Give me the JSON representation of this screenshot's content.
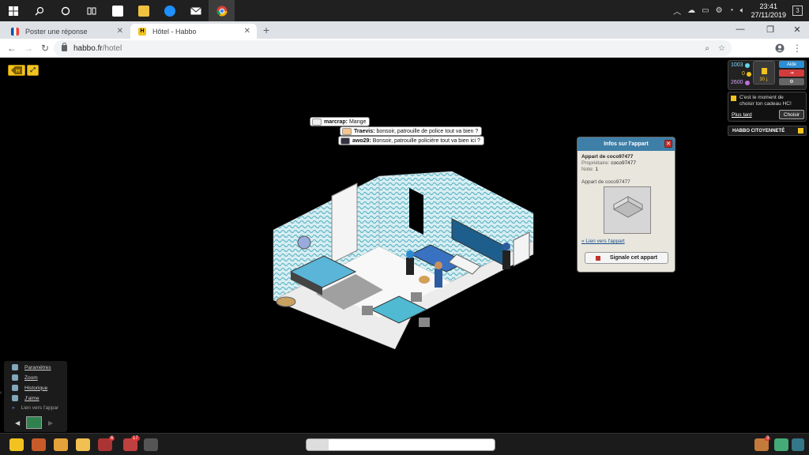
{
  "taskbar": {
    "clock_time": "23:41",
    "clock_date": "27/11/2019",
    "notifications": "3"
  },
  "tabs": [
    {
      "title": "Poster une réponse"
    },
    {
      "title": "Hôtel - Habbo"
    }
  ],
  "address": {
    "host": "habbo.fr",
    "path": "/hotel"
  },
  "chat": [
    {
      "user": "marcrap:",
      "text": "Mange"
    },
    {
      "user": "Traevis:",
      "text": "bonsoir, patrouille de police tout va bien ?"
    },
    {
      "user": "awo29:",
      "text": "Bonsoir, patrouille policière tout va bien ici ?"
    }
  ],
  "currency": {
    "diamonds": "1003",
    "credits": "0",
    "duckets": "2600",
    "hc_days": "30 j.",
    "help_label": "Aide"
  },
  "hc_gift": {
    "message": "C'est le moment de choisir ton cadeau HC!",
    "later_label": "Plus tard",
    "choose_label": "Choisir"
  },
  "citizen_label": "HABBO CITOYENNETÉ",
  "room_info": {
    "title": "Infos sur l'appart",
    "room_name": "Appart de coco97477",
    "owner_label": "Propriétaire:",
    "owner": "coco97477",
    "rating_label": "Note:",
    "rating": "1",
    "thumb_caption": "Appart de coco97477",
    "link_label": "Lien vers l'appart",
    "report_label": "Signale cet appart"
  },
  "room_menu": {
    "items": [
      "Paramètres",
      "Zoom",
      "Historique",
      "J'aime",
      "Lien vers l'appar"
    ]
  },
  "toolbar": {
    "inventory_badge": "6",
    "friends_badge": "17",
    "messenger_badge": "3"
  },
  "colors": {
    "accent_yellow": "#f2c320",
    "window_blue": "#3e7fa8",
    "close_red": "#c0312d"
  }
}
